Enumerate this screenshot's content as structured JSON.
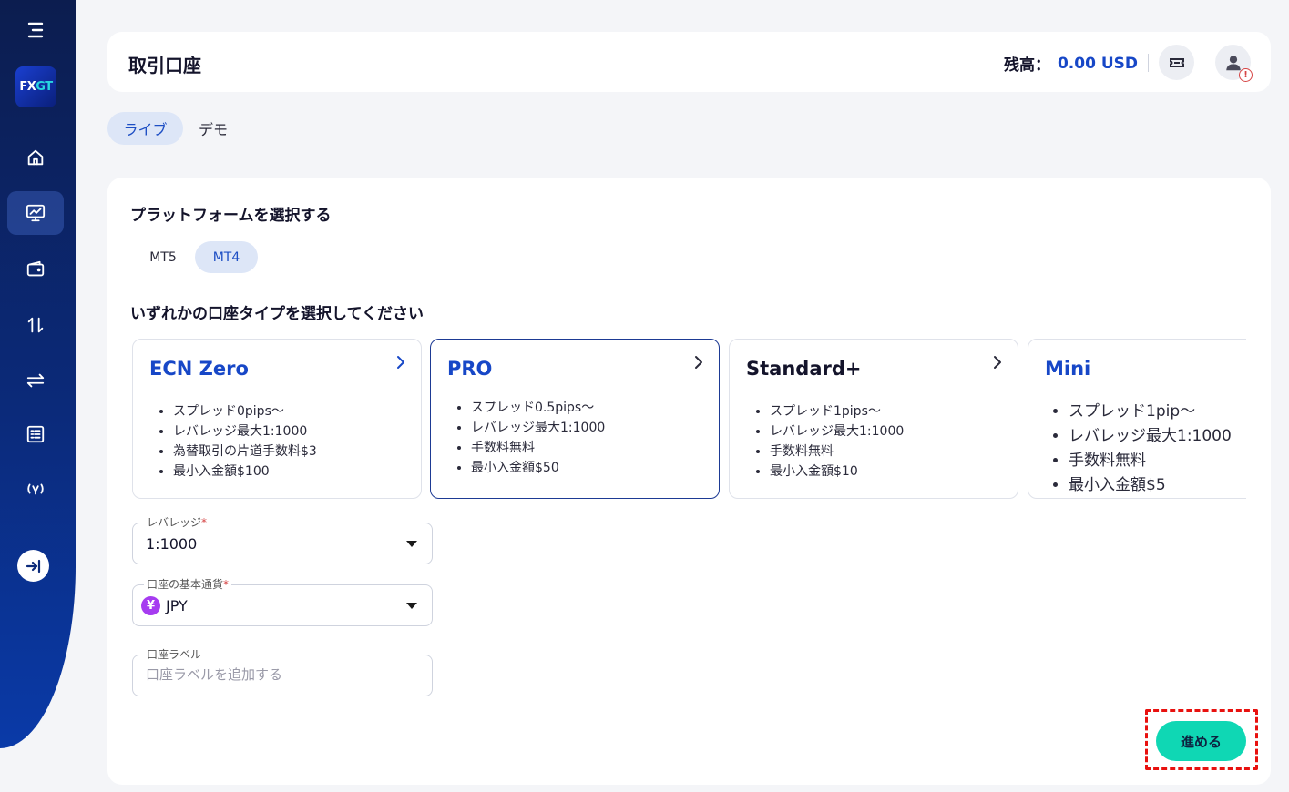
{
  "sidebar": {
    "logo": {
      "left": "FX",
      "right": "GT"
    },
    "items": [
      {
        "name": "home",
        "icon": "home-icon"
      },
      {
        "name": "accounts",
        "icon": "chart-monitor-icon",
        "active": true
      },
      {
        "name": "wallet",
        "icon": "wallet-icon"
      },
      {
        "name": "transfer",
        "icon": "arrows-up-down-icon"
      },
      {
        "name": "exchange",
        "icon": "arrows-left-right-icon"
      },
      {
        "name": "history",
        "icon": "list-icon"
      },
      {
        "name": "partner",
        "icon": "signal-icon"
      }
    ]
  },
  "header": {
    "title": "取引口座",
    "balance_label": "残高：",
    "balance_value": "0.00 USD",
    "alert_symbol": "!"
  },
  "env_tabs": [
    {
      "label": "ライブ",
      "active": true
    },
    {
      "label": "デモ",
      "active": false
    }
  ],
  "platform": {
    "title": "プラットフォームを選択する",
    "tabs": [
      {
        "label": "MT5",
        "active": false
      },
      {
        "label": "MT4",
        "active": true
      }
    ]
  },
  "account_types": {
    "title": "いずれかの口座タイプを選択してください",
    "cards": [
      {
        "name": "ECN Zero",
        "features": [
          "スプレッド0pips〜",
          "レバレッジ最大1:1000",
          "為替取引の片道手数料$3",
          "最小入金額$100"
        ]
      },
      {
        "name": "PRO",
        "selected": true,
        "features": [
          "スプレッド0.5pips〜",
          "レバレッジ最大1:1000",
          "手数料無料",
          "最小入金額$50"
        ]
      },
      {
        "name": "Standard+",
        "features": [
          "スプレッド1pips〜",
          "レバレッジ最大1:1000",
          "手数料無料",
          "最小入金額$10"
        ]
      },
      {
        "name": "Mini",
        "features": [
          "スプレッド1pip〜",
          "レバレッジ最大1:1000",
          "手数料無料",
          "最小入金額$5"
        ]
      }
    ]
  },
  "form": {
    "leverage": {
      "label": "レバレッジ",
      "required": "*",
      "value": "1:1000"
    },
    "currency": {
      "label": "口座の基本通貨",
      "required": "*",
      "value": "JPY",
      "symbol": "¥"
    },
    "account_label": {
      "label": "口座ラベル",
      "placeholder": "口座ラベルを追加する",
      "value": ""
    }
  },
  "proceed_label": "進める",
  "colors": {
    "accent": "#1747c7",
    "proceed": "#0fd7b4",
    "highlight": "#e8110f"
  }
}
